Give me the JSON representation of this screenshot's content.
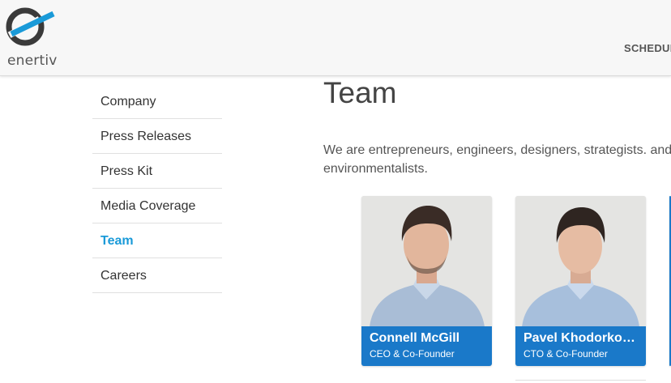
{
  "header": {
    "logo_text": "enertiv",
    "nav_link": "SCHEDUL"
  },
  "sidebar": {
    "items": [
      {
        "label": "Company"
      },
      {
        "label": "Press Releases"
      },
      {
        "label": "Press Kit"
      },
      {
        "label": "Media Coverage"
      },
      {
        "label": "Team",
        "active": true
      },
      {
        "label": "Careers"
      }
    ]
  },
  "main": {
    "title": "Team",
    "intro_line1": "We are entrepreneurs, engineers, designers, strategists. and m",
    "intro_line2": "environmentalists."
  },
  "team": [
    {
      "name": "Connell McGill",
      "role": "CEO & Co-Founder"
    },
    {
      "name": "Pavel Khodorkov…",
      "role": "CTO & Co-Founder"
    }
  ],
  "colors": {
    "accent": "#1a9ad8",
    "caption_bg": "#1a79c9"
  }
}
